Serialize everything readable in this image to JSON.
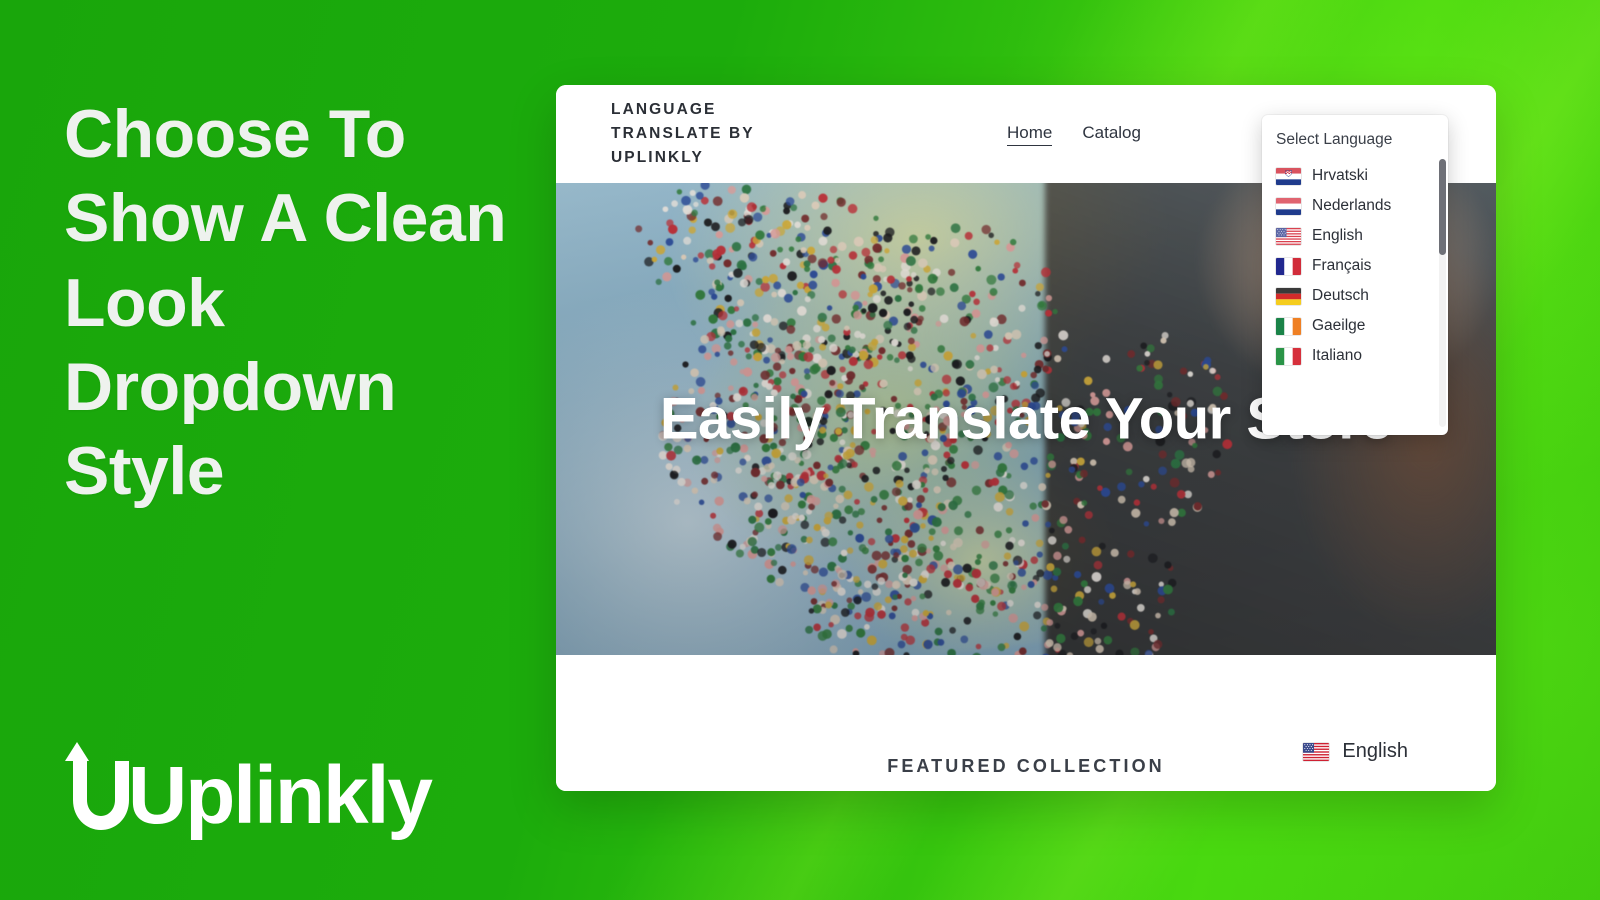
{
  "promo": {
    "headline": "Choose To Show A Clean Look Dropdown Style",
    "logo_wordmark": "Uplinkly",
    "background_color": "#1aa80c",
    "headline_color": "#eef2ee"
  },
  "store": {
    "brand": "LANGUAGE TRANSLATE BY UPLINKLY",
    "nav": [
      {
        "label": "Home",
        "active": true
      },
      {
        "label": "Catalog",
        "active": false
      }
    ],
    "icons": [
      {
        "name": "search-icon"
      },
      {
        "name": "shopping-bag-icon"
      }
    ],
    "hero": {
      "title": "Easily Translate Your Store",
      "image_description": "World map covered in colorful push pins with a hand pointing"
    },
    "featured_section": {
      "title": "FEATURED COLLECTION"
    },
    "language_pill": {
      "flag": "us-flag",
      "label": "English"
    }
  },
  "language_dropdown": {
    "title": "Select Language",
    "scroll_position": "top",
    "options": [
      {
        "label": "Hrvatski",
        "flag": "hr-flag"
      },
      {
        "label": "Nederlands",
        "flag": "nl-flag"
      },
      {
        "label": "English",
        "flag": "us-flag"
      },
      {
        "label": "Français",
        "flag": "fr-flag"
      },
      {
        "label": "Deutsch",
        "flag": "de-flag"
      },
      {
        "label": "Gaeilge",
        "flag": "ie-flag"
      },
      {
        "label": "Italiano",
        "flag": "it-flag"
      }
    ]
  }
}
